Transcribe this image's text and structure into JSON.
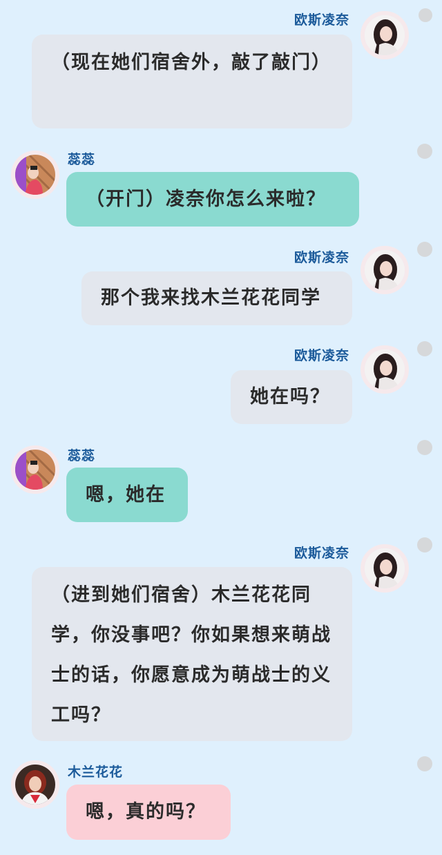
{
  "messages": [
    {
      "side": "right",
      "sender": "欧斯凌奈",
      "avatar": "girl-avatar",
      "text": "（现在她们宿舍外，敲了敲门）",
      "color": "#e3e7ee"
    },
    {
      "side": "left",
      "sender": "蕊蕊",
      "avatar": "mascot-avatar",
      "text": "（开门）凌奈你怎么来啦？",
      "color": "#8adad0"
    },
    {
      "side": "right",
      "sender": "欧斯凌奈",
      "avatar": "girl-avatar",
      "text": "那个我来找木兰花花同学",
      "color": "#e3e7ee"
    },
    {
      "side": "right",
      "sender": "欧斯凌奈",
      "avatar": "girl-avatar",
      "text": "她在吗？",
      "color": "#e3e7ee"
    },
    {
      "side": "left",
      "sender": "蕊蕊",
      "avatar": "mascot-avatar",
      "text": "嗯，她在",
      "color": "#8adad0"
    },
    {
      "side": "right",
      "sender": "欧斯凌奈",
      "avatar": "girl-avatar",
      "text": "（进到她们宿舍）木兰花花同学，你没事吧？你如果想来萌战士的话，你愿意成为萌战士的义工吗？",
      "color": "#e3e7ee"
    },
    {
      "side": "left",
      "sender": "木兰花花",
      "avatar": "redhair-avatar",
      "text": "嗯，真的吗？",
      "color": "#fbcfd6"
    }
  ]
}
